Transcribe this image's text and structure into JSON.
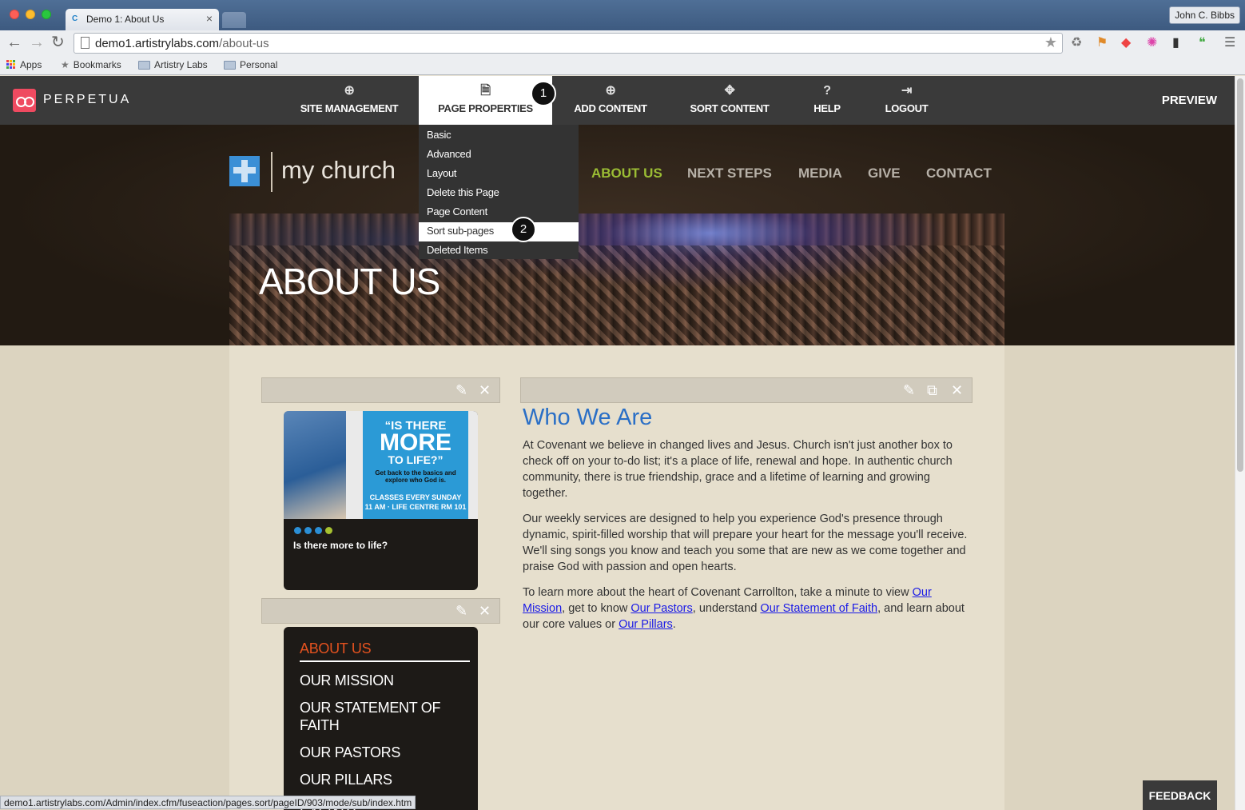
{
  "browser": {
    "tab_title": "Demo 1: About Us",
    "tab_favicon": "C",
    "profile_name": "John C. Bibbs",
    "url_host": "demo1.artistrylabs.com",
    "url_path": "/about-us",
    "bookmarks": [
      "Apps",
      "Bookmarks",
      "Artistry Labs",
      "Personal"
    ],
    "status_url": "demo1.artistrylabs.com/Admin/index.cfm/fuseaction/pages.sort/pageID/903/mode/sub/index.htm"
  },
  "cms": {
    "logo": "PERPETUA",
    "menu": [
      {
        "label": "SITE MANAGEMENT",
        "icon": "globe-icon"
      },
      {
        "label": "PAGE PROPERTIES",
        "icon": "document-icon"
      },
      {
        "label": "ADD CONTENT",
        "icon": "plus-circle-icon"
      },
      {
        "label": "SORT CONTENT",
        "icon": "move-arrows-icon"
      },
      {
        "label": "HELP",
        "icon": "question-icon"
      },
      {
        "label": "LOGOUT",
        "icon": "logout-icon"
      }
    ],
    "preview": "PREVIEW",
    "dropdown": [
      "Basic",
      "Advanced",
      "Layout",
      "Delete this Page",
      "Page Content",
      "Sort sub-pages",
      "Deleted Items"
    ],
    "badges": [
      "1",
      "2"
    ],
    "feedback": "FEEDBACK"
  },
  "site": {
    "logo_text": "my church",
    "nav": [
      "ABOUT US",
      "NEXT STEPS",
      "MEDIA",
      "GIVE",
      "CONTACT"
    ],
    "banner_title": "ABOUT US",
    "promo": {
      "line1": "“IS THERE",
      "line2": "MORE",
      "line3": "TO LIFE?”",
      "line4": "Get back to the basics and explore who God is.",
      "line5": "CLASSES EVERY SUNDAY",
      "line6": "11 AM · LIFE CENTRE RM 101",
      "caption": "Is there more to life?"
    },
    "subnav": [
      "ABOUT US",
      "OUR MISSION",
      "OUR STATEMENT OF FAITH",
      "OUR PASTORS",
      "OUR PILLARS",
      "EVENTS"
    ],
    "main": {
      "title": "Who We Are",
      "p1": "At Covenant we believe in changed lives and Jesus. Church isn't just another box to check off on your to-do list; it's a place of life, renewal and hope. In authentic church community, there is true friendship, grace and a lifetime of learning and growing together.",
      "p2": "Our weekly services are designed to help you experience God's presence through dynamic, spirit-filled worship that will prepare your heart for the message you'll receive. We'll sing songs you know and teach you some that are new as we come together and praise God with passion and open hearts.",
      "p3_a": "To learn more about the heart of Covenant Carrollton, take a minute to view ",
      "link_mission": "Our Mission",
      "p3_b": ", get to know ",
      "link_pastors": "Our Pastors",
      "p3_c": ", understand ",
      "link_faith": "Our Statement of Faith",
      "p3_d": ", and learn about our core values or ",
      "link_pillars": "Our Pillars",
      "p3_e": "."
    }
  },
  "colors": {
    "accent_green": "#9bbd34",
    "title_blue": "#2a6fc6",
    "cms_bar": "#3a3a3a",
    "brand_pink": "#ef4a60"
  }
}
